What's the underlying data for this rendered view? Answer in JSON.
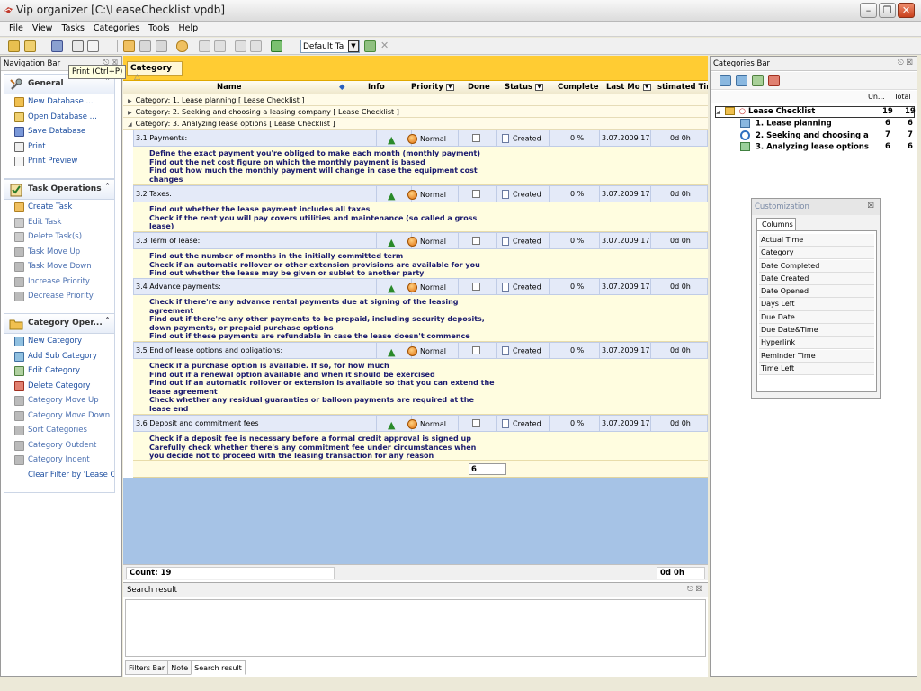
{
  "app": {
    "title": "Vip organizer [C:\\LeaseChecklist.vpdb]"
  },
  "menu": [
    "File",
    "View",
    "Tasks",
    "Categories",
    "Tools",
    "Help"
  ],
  "toolbar": {
    "view_select": "Default Ta",
    "tooltip": "Print (Ctrl+P)"
  },
  "nav": {
    "title": "Navigation Bar",
    "groups": [
      {
        "title": "General",
        "items": [
          "New Database ...",
          "Open Database ...",
          "Save Database",
          "Print",
          "Print Preview"
        ]
      },
      {
        "title": "Task Operations",
        "items": [
          "Create Task",
          "Edit Task",
          "Delete Task(s)",
          "Task Move Up",
          "Task Move Down",
          "Increase Priority",
          "Decrease Priority"
        ]
      },
      {
        "title": "Category Oper...",
        "items": [
          "New Category",
          "Add Sub Category",
          "Edit Category",
          "Delete Category",
          "Category Move Up",
          "Category Move Down",
          "Sort Categories",
          "Category Outdent",
          "Category Indent",
          "Clear Filter by 'Lease C..."
        ]
      }
    ]
  },
  "grid": {
    "group_by": "Category",
    "group_by_arrow": "△",
    "columns": {
      "name": "Name",
      "info": "Info",
      "priority": "Priority",
      "done": "Done",
      "status": "Status",
      "complete": "Complete",
      "last_modified": "Last Mo",
      "estimated": "stimated Tim"
    },
    "groups": [
      {
        "label": "Category: 1. Lease planning   [ Lease Checklist ]",
        "expanded": false
      },
      {
        "label": "Category: 2. Seeking and choosing a leasing company   [ Lease Checklist ]",
        "expanded": false
      },
      {
        "label": "Category: 3. Analyzing lease options   [ Lease Checklist ]",
        "expanded": true
      }
    ],
    "tasks": [
      {
        "name": "3.1 Payments:",
        "priority": "Normal",
        "status": "Created",
        "complete": "0 %",
        "last_modified": "3.07.2009 17:(",
        "estimated": "0d 0h",
        "notes": [
          "Define the exact payment you're obliged to make each month (monthly payment)",
          "Find out the net cost figure on which the monthly payment is based",
          "Find out how much the monthly payment will change in case the equipment cost",
          "changes"
        ]
      },
      {
        "name": "3.2 Taxes:",
        "priority": "Normal",
        "status": "Created",
        "complete": "0 %",
        "last_modified": "3.07.2009 17:(",
        "estimated": "0d 0h",
        "notes": [
          "Find out whether the lease payment includes all taxes",
          "Check if the rent you will pay covers utilities and maintenance (so called a gross",
          "lease)"
        ]
      },
      {
        "name": "3.3 Term of lease:",
        "priority": "Normal",
        "status": "Created",
        "complete": "0 %",
        "last_modified": "3.07.2009 17:1",
        "estimated": "0d 0h",
        "notes": [
          "Find out the number of months in the initially committed term",
          "Check if an automatic rollover or other extension provisions are available for you",
          "Find out whether the lease may be given or sublet to another party"
        ]
      },
      {
        "name": "3.4 Advance payments:",
        "priority": "Normal",
        "status": "Created",
        "complete": "0 %",
        "last_modified": "3.07.2009 17:1",
        "estimated": "0d 0h",
        "notes": [
          "Check if there're any advance rental payments due at signing of the leasing",
          "agreement",
          "Find out if there're any other payments to be prepaid, including security deposits,",
          "down payments, or prepaid purchase options",
          "Find out if these payments are refundable in case the lease doesn't commence"
        ]
      },
      {
        "name": "3.5 End of lease options and obligations:",
        "priority": "Normal",
        "status": "Created",
        "complete": "0 %",
        "last_modified": "3.07.2009 17:1",
        "estimated": "0d 0h",
        "notes": [
          "Check if a purchase option is available. If so, for how much",
          "Find out if a renewal option available and when it should be exercised",
          "Find out if an automatic rollover or extension is available so that you can extend the",
          "lease agreement",
          "Check whether any residual guaranties or balloon payments are required at the",
          "lease end"
        ]
      },
      {
        "name": "3.6 Deposit and commitment fees",
        "priority": "Normal",
        "status": "Created",
        "complete": "0 %",
        "last_modified": "3.07.2009 17:1",
        "estimated": "0d 0h",
        "notes": [
          "Check if a deposit fee is necessary before a formal credit approval is signed up",
          "Carefully check whether there's any commitment fee under circumstances when",
          "you decide not to proceed with the leasing transaction for any reason"
        ]
      }
    ],
    "group_count": "6",
    "footer_count": "Count: 19",
    "footer_total": "0d 0h"
  },
  "search": {
    "title": "Search result",
    "tabs": [
      "Filters Bar",
      "Note",
      "Search result"
    ],
    "active_tab": "Search result"
  },
  "categories": {
    "title": "Categories Bar",
    "col_uncompleted": "Un...",
    "col_total": "Total",
    "nodes": [
      {
        "label": "Lease Checklist",
        "uncompleted": "19",
        "total": "19",
        "level": 0
      },
      {
        "label": "1. Lease planning",
        "uncompleted": "6",
        "total": "6",
        "level": 1
      },
      {
        "label": "2. Seeking and choosing a",
        "uncompleted": "7",
        "total": "7",
        "level": 1
      },
      {
        "label": "3. Analyzing lease options",
        "uncompleted": "6",
        "total": "6",
        "level": 1
      }
    ]
  },
  "customization": {
    "title": "Customization",
    "tab": "Columns",
    "columns": [
      "Actual Time",
      "Category",
      "Date Completed",
      "Date Created",
      "Date Opened",
      "Days Left",
      "Due Date",
      "Due Date&Time",
      "Hyperlink",
      "Reminder Time",
      "Time Left"
    ]
  }
}
